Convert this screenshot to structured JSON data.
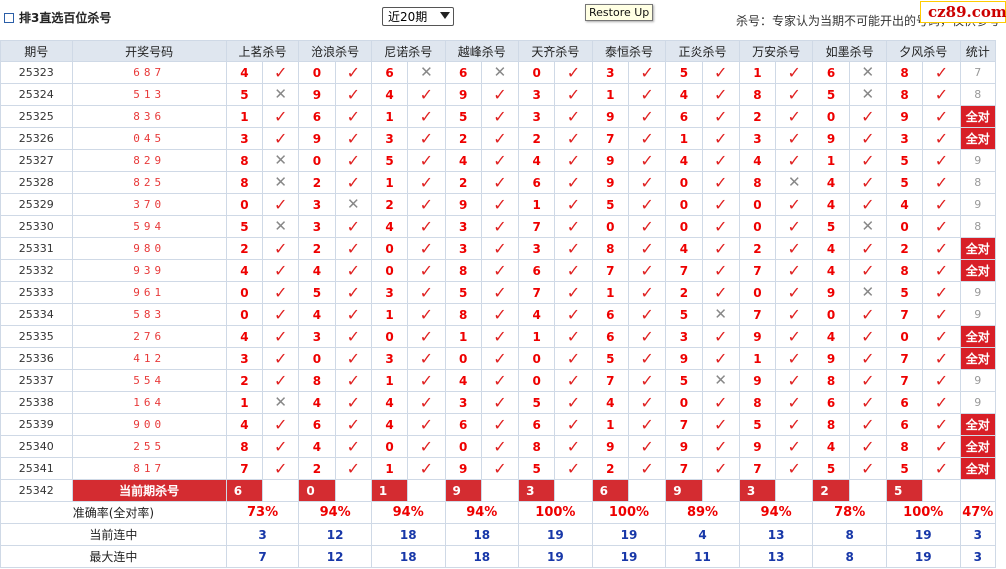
{
  "header": {
    "title": "排3直选百位杀号",
    "select_value": "近20期",
    "tooltip": "Restore Up",
    "note": "杀号：专家认为当期不可能开出的号码，仅供参考",
    "logo": "cz89.com"
  },
  "columns": {
    "period": "期号",
    "draw": "开奖号码",
    "experts": [
      "上茗杀号",
      "沧浪杀号",
      "尼诺杀号",
      "越峰杀号",
      "天齐杀号",
      "泰恒杀号",
      "正炎杀号",
      "万安杀号",
      "如墨杀号",
      "夕风杀号"
    ],
    "stat": "统计"
  },
  "rows": [
    {
      "period": "25323",
      "draw": "687",
      "kills": [
        4,
        0,
        6,
        6,
        0,
        3,
        5,
        1,
        6,
        8
      ],
      "hit": [
        1,
        1,
        0,
        0,
        1,
        1,
        1,
        1,
        0,
        1
      ],
      "stat": "7"
    },
    {
      "period": "25324",
      "draw": "513",
      "kills": [
        5,
        9,
        4,
        9,
        3,
        1,
        4,
        8,
        5,
        8
      ],
      "hit": [
        0,
        1,
        1,
        1,
        1,
        1,
        1,
        1,
        0,
        1
      ],
      "stat": "8"
    },
    {
      "period": "25325",
      "draw": "836",
      "kills": [
        1,
        6,
        1,
        5,
        3,
        9,
        6,
        2,
        0,
        9
      ],
      "hit": [
        1,
        1,
        1,
        1,
        1,
        1,
        1,
        1,
        1,
        1
      ],
      "stat": "全对"
    },
    {
      "period": "25326",
      "draw": "045",
      "kills": [
        3,
        9,
        3,
        2,
        2,
        7,
        1,
        3,
        9,
        3
      ],
      "hit": [
        1,
        1,
        1,
        1,
        1,
        1,
        1,
        1,
        1,
        1
      ],
      "stat": "全对"
    },
    {
      "period": "25327",
      "draw": "829",
      "kills": [
        8,
        0,
        5,
        4,
        4,
        9,
        4,
        4,
        1,
        5
      ],
      "hit": [
        0,
        1,
        1,
        1,
        1,
        1,
        1,
        1,
        1,
        1
      ],
      "stat": "9"
    },
    {
      "period": "25328",
      "draw": "825",
      "kills": [
        8,
        2,
        1,
        2,
        6,
        9,
        0,
        8,
        4,
        5
      ],
      "hit": [
        0,
        1,
        1,
        1,
        1,
        1,
        1,
        0,
        1,
        1
      ],
      "stat": "8"
    },
    {
      "period": "25329",
      "draw": "370",
      "kills": [
        0,
        3,
        2,
        9,
        1,
        5,
        0,
        0,
        4,
        4
      ],
      "hit": [
        1,
        0,
        1,
        1,
        1,
        1,
        1,
        1,
        1,
        1
      ],
      "stat": "9"
    },
    {
      "period": "25330",
      "draw": "594",
      "kills": [
        5,
        3,
        4,
        3,
        7,
        0,
        0,
        0,
        5,
        0
      ],
      "hit": [
        0,
        1,
        1,
        1,
        1,
        1,
        1,
        1,
        0,
        1
      ],
      "stat": "8"
    },
    {
      "period": "25331",
      "draw": "980",
      "kills": [
        2,
        2,
        0,
        3,
        3,
        8,
        4,
        2,
        4,
        2
      ],
      "hit": [
        1,
        1,
        1,
        1,
        1,
        1,
        1,
        1,
        1,
        1
      ],
      "stat": "全对"
    },
    {
      "period": "25332",
      "draw": "939",
      "kills": [
        4,
        4,
        0,
        8,
        6,
        7,
        7,
        7,
        4,
        8
      ],
      "hit": [
        1,
        1,
        1,
        1,
        1,
        1,
        1,
        1,
        1,
        1
      ],
      "stat": "全对"
    },
    {
      "period": "25333",
      "draw": "961",
      "kills": [
        0,
        5,
        3,
        5,
        7,
        1,
        2,
        0,
        9,
        5
      ],
      "hit": [
        1,
        1,
        1,
        1,
        1,
        1,
        1,
        1,
        0,
        1
      ],
      "stat": "9"
    },
    {
      "period": "25334",
      "draw": "583",
      "kills": [
        0,
        4,
        1,
        8,
        4,
        6,
        5,
        7,
        0,
        7
      ],
      "hit": [
        1,
        1,
        1,
        1,
        1,
        1,
        0,
        1,
        1,
        1
      ],
      "stat": "9"
    },
    {
      "period": "25335",
      "draw": "276",
      "kills": [
        4,
        3,
        0,
        1,
        1,
        6,
        3,
        9,
        4,
        0
      ],
      "hit": [
        1,
        1,
        1,
        1,
        1,
        1,
        1,
        1,
        1,
        1
      ],
      "stat": "全对"
    },
    {
      "period": "25336",
      "draw": "412",
      "kills": [
        3,
        0,
        3,
        0,
        0,
        5,
        9,
        1,
        9,
        7
      ],
      "hit": [
        1,
        1,
        1,
        1,
        1,
        1,
        1,
        1,
        1,
        1
      ],
      "stat": "全对"
    },
    {
      "period": "25337",
      "draw": "554",
      "kills": [
        2,
        8,
        1,
        4,
        0,
        7,
        5,
        9,
        8,
        7
      ],
      "hit": [
        1,
        1,
        1,
        1,
        1,
        1,
        0,
        1,
        1,
        1
      ],
      "stat": "9"
    },
    {
      "period": "25338",
      "draw": "164",
      "kills": [
        1,
        4,
        4,
        3,
        5,
        4,
        0,
        8,
        6,
        6
      ],
      "hit": [
        0,
        1,
        1,
        1,
        1,
        1,
        1,
        1,
        1,
        1
      ],
      "stat": "9"
    },
    {
      "period": "25339",
      "draw": "900",
      "kills": [
        4,
        6,
        4,
        6,
        6,
        1,
        7,
        5,
        8,
        6
      ],
      "hit": [
        1,
        1,
        1,
        1,
        1,
        1,
        1,
        1,
        1,
        1
      ],
      "stat": "全对"
    },
    {
      "period": "25340",
      "draw": "255",
      "kills": [
        8,
        4,
        0,
        0,
        8,
        9,
        9,
        9,
        4,
        8
      ],
      "hit": [
        1,
        1,
        1,
        1,
        1,
        1,
        1,
        1,
        1,
        1
      ],
      "stat": "全对"
    },
    {
      "period": "25341",
      "draw": "817",
      "kills": [
        7,
        2,
        1,
        9,
        5,
        2,
        7,
        7,
        5,
        5
      ],
      "hit": [
        1,
        1,
        1,
        1,
        1,
        1,
        1,
        1,
        1,
        1
      ],
      "stat": "全对"
    }
  ],
  "current": {
    "period": "25342",
    "label": "当前期杀号",
    "kills": [
      "6",
      "0",
      "1",
      "9",
      "3",
      "6",
      "9",
      "3",
      "2",
      "5"
    ]
  },
  "footer": {
    "accuracy_label": "准确率(全对率)",
    "accuracy": [
      "73%",
      "94%",
      "94%",
      "94%",
      "100%",
      "100%",
      "89%",
      "94%",
      "78%",
      "100%",
      "47%"
    ],
    "streak_label": "当前连中",
    "streak": [
      "3",
      "12",
      "18",
      "18",
      "19",
      "19",
      "4",
      "13",
      "8",
      "19",
      "3"
    ],
    "max_label": "最大连中",
    "max": [
      "7",
      "12",
      "18",
      "18",
      "19",
      "19",
      "11",
      "13",
      "8",
      "19",
      "3"
    ]
  },
  "symbols": {
    "check": "✓",
    "cross": "✕"
  },
  "colors": {
    "accent": "#d81f27",
    "header_bg": "#dfe6ef",
    "count_blue": "#1737a8"
  }
}
